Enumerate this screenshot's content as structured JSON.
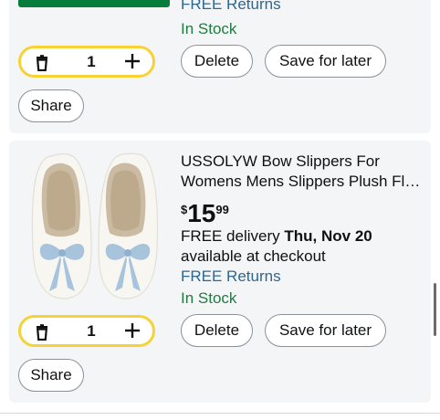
{
  "item_top": {
    "free_returns": "FREE Returns",
    "stock": "In Stock",
    "quantity": "1",
    "delete_label": "Delete",
    "save_label": "Save for later",
    "share_label": "Share"
  },
  "item_bottom": {
    "title_line1": "USSOLYW Bow Slippers For",
    "title_line2": "Womens Mens Slippers Plush Fl…",
    "price_currency": "$",
    "price_whole": "15",
    "price_fraction": "99",
    "delivery_prefix": "FREE delivery ",
    "delivery_date": "Thu, Nov 20",
    "delivery_suffix": "available at checkout",
    "free_returns": "FREE Returns",
    "stock": "In Stock",
    "quantity": "1",
    "delete_label": "Delete",
    "save_label": "Save for later",
    "share_label": "Share"
  },
  "icons": {
    "trash": "trash-icon",
    "plus": "plus-icon"
  },
  "colors": {
    "link_blue": "#2f6690",
    "stock_green": "#237a43",
    "stepper_yellow": "#f5d236",
    "card_background": "#f4f5f6"
  }
}
